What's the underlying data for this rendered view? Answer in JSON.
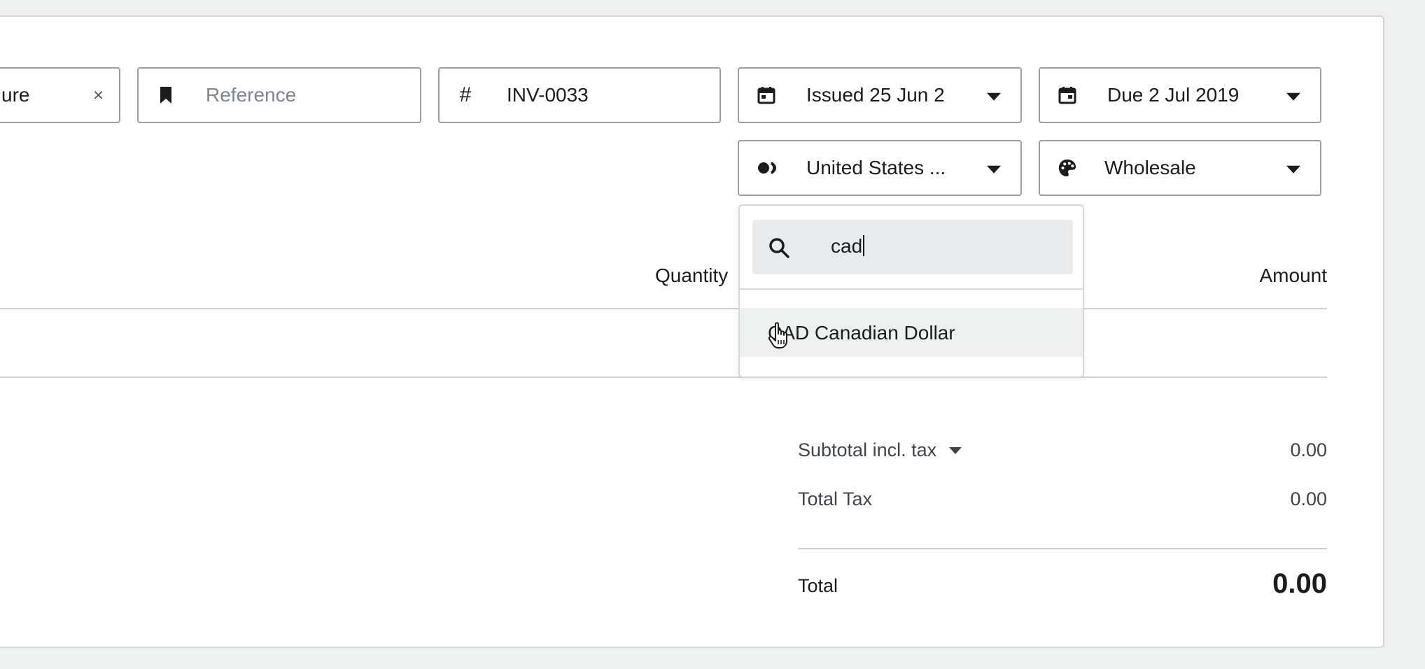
{
  "fields": {
    "contact": {
      "value": "ure",
      "clear": "×"
    },
    "reference": {
      "placeholder": "Reference"
    },
    "invoice_number": {
      "prefix": "#",
      "value": "INV-0033"
    },
    "issued": {
      "value": "Issued 25 Jun 2"
    },
    "due": {
      "value": "Due 2 Jul 2019"
    },
    "currency": {
      "value": "United States ..."
    },
    "branding": {
      "value": "Wholesale"
    }
  },
  "table": {
    "columns": {
      "quantity": "Quantity",
      "amount": "Amount"
    }
  },
  "currency_dropdown": {
    "search_value": "cad",
    "options": [
      "CAD Canadian Dollar"
    ]
  },
  "summary": {
    "subtotal_label": "Subtotal incl. tax",
    "subtotal_value": "0.00",
    "tax_label": "Total Tax",
    "tax_value": "0.00",
    "total_label": "Total",
    "total_value": "0.00"
  },
  "icons": {
    "reference": "bookmark-icon",
    "issued": "calendar-icon",
    "due": "calendar-icon",
    "currency": "currency-icon",
    "branding": "palette-icon",
    "search": "search-icon",
    "cursor": "hand-pointer-icon"
  }
}
